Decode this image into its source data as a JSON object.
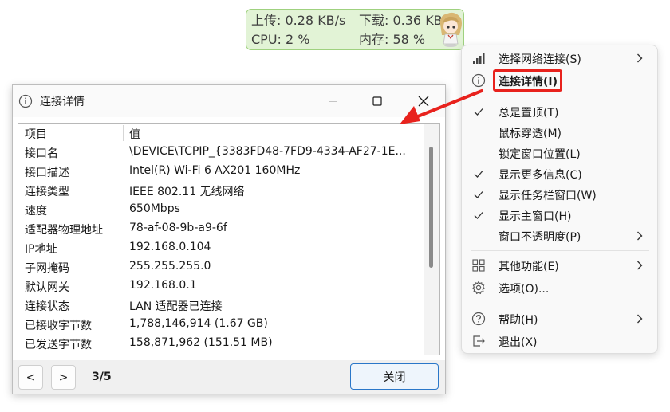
{
  "widget": {
    "upload": "上传: 0.28 KB/s",
    "download": "下载: 0.36 KB/s",
    "cpu": "CPU: 2 %",
    "memory": "内存: 58 %"
  },
  "dialog": {
    "title": "连接详情",
    "header": {
      "item": "项目",
      "value": "值"
    },
    "rows": [
      {
        "name": "接口名",
        "value": "\\DEVICE\\TCPIP_{3383FD48-7FD9-4334-AF27-1E..."
      },
      {
        "name": "接口描述",
        "value": "Intel(R) Wi-Fi 6 AX201 160MHz"
      },
      {
        "name": "连接类型",
        "value": "IEEE 802.11 无线网络"
      },
      {
        "name": "速度",
        "value": "650Mbps"
      },
      {
        "name": "适配器物理地址",
        "value": "78-af-08-9b-a9-6f"
      },
      {
        "name": "IP地址",
        "value": "192.168.0.104"
      },
      {
        "name": "子网掩码",
        "value": "255.255.255.0"
      },
      {
        "name": "默认网关",
        "value": "192.168.0.1"
      },
      {
        "name": "连接状态",
        "value": "LAN 适配器已连接"
      },
      {
        "name": "已接收字节数",
        "value": "1,788,146,914 (1.67 GB)"
      },
      {
        "name": "已发送字节数",
        "value": "158,871,962 (151.51 MB)"
      }
    ],
    "prev_label": "<",
    "next_label": ">",
    "page_indicator": "3/5",
    "close_label": "关闭"
  },
  "menu": {
    "items": [
      {
        "label": "选择网络连接(S)",
        "icon": "signal-bars-icon",
        "submenu": true
      },
      {
        "label": "连接详情(I)",
        "icon": "info-icon",
        "highlighted": true
      },
      {
        "label": "总是置顶(T)",
        "checked": true
      },
      {
        "label": "鼠标穿透(M)"
      },
      {
        "label": "锁定窗口位置(L)"
      },
      {
        "label": "显示更多信息(C)",
        "checked": true
      },
      {
        "label": "显示任务栏窗口(W)",
        "checked": true
      },
      {
        "label": "显示主窗口(H)",
        "checked": true
      },
      {
        "label": "窗口不透明度(P)",
        "submenu": true
      },
      {
        "label": "其他功能(E)",
        "icon": "grid-icon",
        "submenu": true
      },
      {
        "label": "选项(O)...",
        "icon": "gear-icon"
      },
      {
        "label": "帮助(H)",
        "icon": "help-icon",
        "submenu": true
      },
      {
        "label": "退出(X)",
        "icon": "exit-icon"
      }
    ]
  },
  "colors": {
    "widget_bg": "#e2f3d6",
    "widget_border": "#9fd17f",
    "highlight": "#e8221d",
    "accent_blue": "#2a77c9"
  }
}
